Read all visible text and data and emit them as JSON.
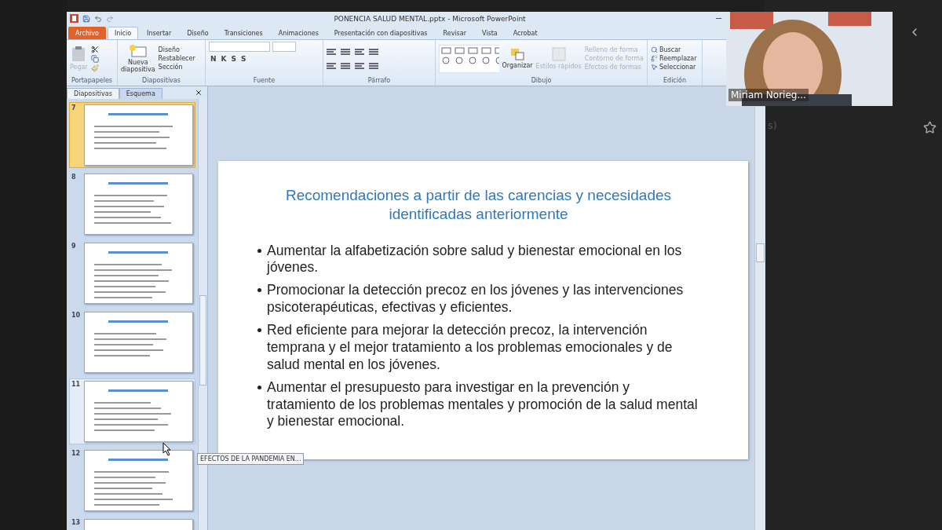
{
  "window": {
    "title": "PONENCIA SALUD MENTAL.pptx - Microsoft PowerPoint"
  },
  "ribbon_tabs": [
    {
      "label": "Archivo",
      "kind": "file",
      "selected": false
    },
    {
      "label": "Inicio",
      "kind": "tab",
      "selected": true
    },
    {
      "label": "Insertar",
      "kind": "tab",
      "selected": false
    },
    {
      "label": "Diseño",
      "kind": "tab",
      "selected": false
    },
    {
      "label": "Transiciones",
      "kind": "tab",
      "selected": false
    },
    {
      "label": "Animaciones",
      "kind": "tab",
      "selected": false
    },
    {
      "label": "Presentación con diapositivas",
      "kind": "tab",
      "selected": false
    },
    {
      "label": "Revisar",
      "kind": "tab",
      "selected": false
    },
    {
      "label": "Vista",
      "kind": "tab",
      "selected": false
    },
    {
      "label": "Acrobat",
      "kind": "tab",
      "selected": false
    }
  ],
  "ribbon": {
    "clipboard": {
      "label": "Portapapeles",
      "paste": {
        "label": "Pegar",
        "disabled": true
      }
    },
    "slides": {
      "label": "Diapositivas",
      "new_slide": [
        "Nueva",
        "diapositiva"
      ],
      "layout": "Diseño",
      "reset": "Restablecer",
      "section": "Sección"
    },
    "font": {
      "label": "Fuente",
      "format_buttons": [
        "N",
        "K",
        "S",
        "S"
      ]
    },
    "paragraph": {
      "label": "Párrafo"
    },
    "drawing": {
      "label": "Dibujo",
      "arrange": "Organizar",
      "quick_styles": {
        "label": "Estilos rápidos",
        "disabled": true
      },
      "shape_options": [
        {
          "label": "Relleno de forma",
          "disabled": true
        },
        {
          "label": "Contorno de forma",
          "disabled": true
        },
        {
          "label": "Efectos de formas",
          "disabled": true
        }
      ]
    },
    "editing": {
      "label": "Edición",
      "items": [
        {
          "label": "Buscar",
          "kind": "find"
        },
        {
          "label": "Reemplazar",
          "kind": "replace"
        },
        {
          "label": "Seleccionar",
          "kind": "select"
        }
      ]
    }
  },
  "side_panel": {
    "tabs": [
      {
        "label": "Diapositivas",
        "selected": true
      },
      {
        "label": "Esquema",
        "selected": false
      }
    ],
    "slides": [
      {
        "number": "7",
        "selected": true,
        "hovered": false
      },
      {
        "number": "8",
        "selected": false,
        "hovered": false
      },
      {
        "number": "9",
        "selected": false,
        "hovered": false
      },
      {
        "number": "10",
        "selected": false,
        "hovered": false
      },
      {
        "number": "11",
        "selected": false,
        "hovered": true
      },
      {
        "number": "12",
        "selected": false,
        "hovered": false
      },
      {
        "number": "13",
        "selected": false,
        "hovered": false
      }
    ]
  },
  "tooltip": "EFECTOS DE LA PANDEMIA EN...",
  "slide": {
    "title": "Recomendaciones a partir de las carencias y necesidades identificadas anteriormente",
    "bullets": [
      "Aumentar la alfabetización sobre salud y bienestar emocional en los jóvenes.",
      "Promocionar la detección precoz en los jóvenes y las intervenciones psicoterapéuticas, efectivas y eficientes.",
      "Red eficiente para mejorar la detección precoz, la intervención temprana y el mejor tratamiento a los problemas emocionales y de salud mental en los jóvenes.",
      "Aumentar el presupuesto para investigar en la prevención y tratamiento de los problemas mentales y promoción de la salud mental y bienestar emocional."
    ]
  },
  "video": {
    "name": "Miriam Norieg..."
  },
  "side_text": "s)"
}
